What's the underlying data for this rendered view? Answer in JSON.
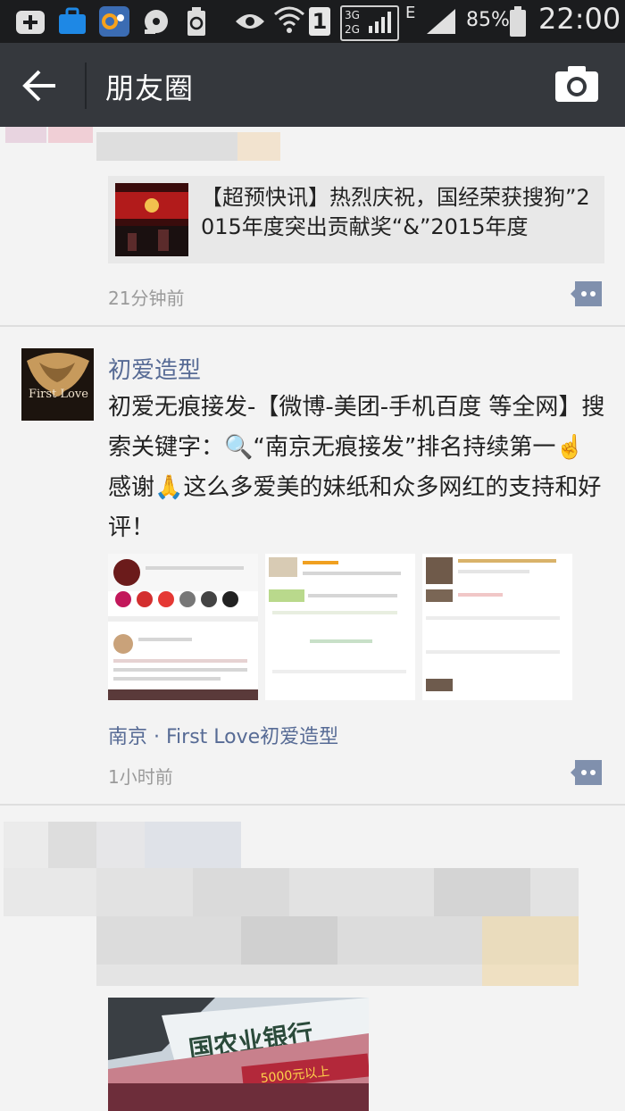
{
  "status_bar": {
    "signal_label_1": "1",
    "net_label": "3G\n2G",
    "net_label_top": "3G",
    "net_label_bottom": "2G",
    "e_label": "E",
    "battery": "85%",
    "time": "22:00"
  },
  "header": {
    "title": "朋友圈"
  },
  "posts": [
    {
      "link_card": {
        "title": "【超预快讯】热烈庆祝，国经荣获搜狗”2015年度突出贡献奖“&”2015年度"
      },
      "time": "21分钟前"
    },
    {
      "author": "初爱造型",
      "text": "初爱无痕接发-【微博-美团-手机百度 等全网】搜索关键字：🔍“南京无痕接发”排名持续第一☝️ 感谢🙏这么多爱美的妹纸和众多网红的支持和好评！",
      "avatar_text": "First Love",
      "location": "南京 · First Love初爱造型",
      "time": "1小时前"
    }
  ],
  "colors": {
    "link": "#576b95",
    "header_bg": "#35383d",
    "status_bg": "#1b1c1e"
  }
}
